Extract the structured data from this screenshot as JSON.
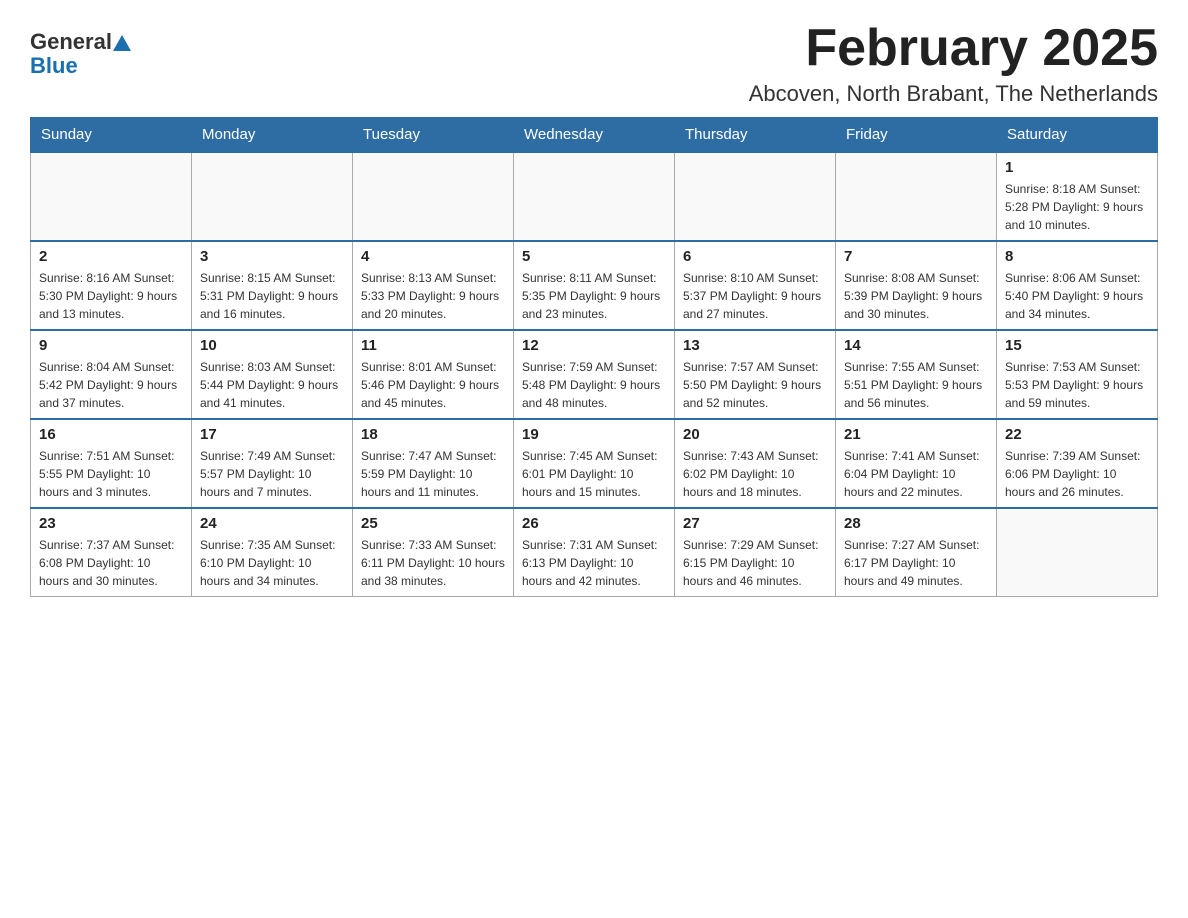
{
  "header": {
    "logo_general": "General",
    "logo_blue": "Blue",
    "month_title": "February 2025",
    "location": "Abcoven, North Brabant, The Netherlands"
  },
  "weekdays": [
    "Sunday",
    "Monday",
    "Tuesday",
    "Wednesday",
    "Thursday",
    "Friday",
    "Saturday"
  ],
  "weeks": [
    {
      "days": [
        {
          "number": "",
          "info": ""
        },
        {
          "number": "",
          "info": ""
        },
        {
          "number": "",
          "info": ""
        },
        {
          "number": "",
          "info": ""
        },
        {
          "number": "",
          "info": ""
        },
        {
          "number": "",
          "info": ""
        },
        {
          "number": "1",
          "info": "Sunrise: 8:18 AM\nSunset: 5:28 PM\nDaylight: 9 hours and 10 minutes."
        }
      ]
    },
    {
      "days": [
        {
          "number": "2",
          "info": "Sunrise: 8:16 AM\nSunset: 5:30 PM\nDaylight: 9 hours and 13 minutes."
        },
        {
          "number": "3",
          "info": "Sunrise: 8:15 AM\nSunset: 5:31 PM\nDaylight: 9 hours and 16 minutes."
        },
        {
          "number": "4",
          "info": "Sunrise: 8:13 AM\nSunset: 5:33 PM\nDaylight: 9 hours and 20 minutes."
        },
        {
          "number": "5",
          "info": "Sunrise: 8:11 AM\nSunset: 5:35 PM\nDaylight: 9 hours and 23 minutes."
        },
        {
          "number": "6",
          "info": "Sunrise: 8:10 AM\nSunset: 5:37 PM\nDaylight: 9 hours and 27 minutes."
        },
        {
          "number": "7",
          "info": "Sunrise: 8:08 AM\nSunset: 5:39 PM\nDaylight: 9 hours and 30 minutes."
        },
        {
          "number": "8",
          "info": "Sunrise: 8:06 AM\nSunset: 5:40 PM\nDaylight: 9 hours and 34 minutes."
        }
      ]
    },
    {
      "days": [
        {
          "number": "9",
          "info": "Sunrise: 8:04 AM\nSunset: 5:42 PM\nDaylight: 9 hours and 37 minutes."
        },
        {
          "number": "10",
          "info": "Sunrise: 8:03 AM\nSunset: 5:44 PM\nDaylight: 9 hours and 41 minutes."
        },
        {
          "number": "11",
          "info": "Sunrise: 8:01 AM\nSunset: 5:46 PM\nDaylight: 9 hours and 45 minutes."
        },
        {
          "number": "12",
          "info": "Sunrise: 7:59 AM\nSunset: 5:48 PM\nDaylight: 9 hours and 48 minutes."
        },
        {
          "number": "13",
          "info": "Sunrise: 7:57 AM\nSunset: 5:50 PM\nDaylight: 9 hours and 52 minutes."
        },
        {
          "number": "14",
          "info": "Sunrise: 7:55 AM\nSunset: 5:51 PM\nDaylight: 9 hours and 56 minutes."
        },
        {
          "number": "15",
          "info": "Sunrise: 7:53 AM\nSunset: 5:53 PM\nDaylight: 9 hours and 59 minutes."
        }
      ]
    },
    {
      "days": [
        {
          "number": "16",
          "info": "Sunrise: 7:51 AM\nSunset: 5:55 PM\nDaylight: 10 hours and 3 minutes."
        },
        {
          "number": "17",
          "info": "Sunrise: 7:49 AM\nSunset: 5:57 PM\nDaylight: 10 hours and 7 minutes."
        },
        {
          "number": "18",
          "info": "Sunrise: 7:47 AM\nSunset: 5:59 PM\nDaylight: 10 hours and 11 minutes."
        },
        {
          "number": "19",
          "info": "Sunrise: 7:45 AM\nSunset: 6:01 PM\nDaylight: 10 hours and 15 minutes."
        },
        {
          "number": "20",
          "info": "Sunrise: 7:43 AM\nSunset: 6:02 PM\nDaylight: 10 hours and 18 minutes."
        },
        {
          "number": "21",
          "info": "Sunrise: 7:41 AM\nSunset: 6:04 PM\nDaylight: 10 hours and 22 minutes."
        },
        {
          "number": "22",
          "info": "Sunrise: 7:39 AM\nSunset: 6:06 PM\nDaylight: 10 hours and 26 minutes."
        }
      ]
    },
    {
      "days": [
        {
          "number": "23",
          "info": "Sunrise: 7:37 AM\nSunset: 6:08 PM\nDaylight: 10 hours and 30 minutes."
        },
        {
          "number": "24",
          "info": "Sunrise: 7:35 AM\nSunset: 6:10 PM\nDaylight: 10 hours and 34 minutes."
        },
        {
          "number": "25",
          "info": "Sunrise: 7:33 AM\nSunset: 6:11 PM\nDaylight: 10 hours and 38 minutes."
        },
        {
          "number": "26",
          "info": "Sunrise: 7:31 AM\nSunset: 6:13 PM\nDaylight: 10 hours and 42 minutes."
        },
        {
          "number": "27",
          "info": "Sunrise: 7:29 AM\nSunset: 6:15 PM\nDaylight: 10 hours and 46 minutes."
        },
        {
          "number": "28",
          "info": "Sunrise: 7:27 AM\nSunset: 6:17 PM\nDaylight: 10 hours and 49 minutes."
        },
        {
          "number": "",
          "info": ""
        }
      ]
    }
  ]
}
